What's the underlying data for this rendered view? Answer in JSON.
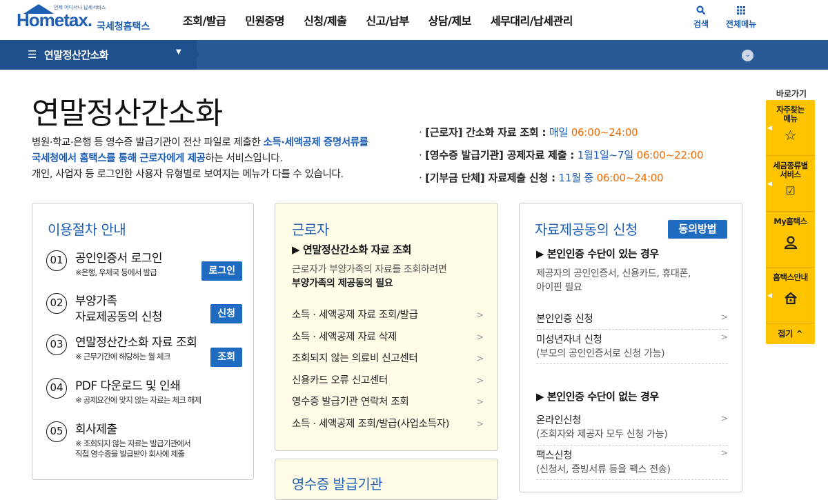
{
  "header": {
    "logo_small": "언제 어디서나 납세서비스",
    "logo_text": "Hometax.",
    "logo_kr": "국세청홈택스",
    "gnb": [
      "조회/발급",
      "민원증명",
      "신청/제출",
      "신고/납부",
      "상담/제보",
      "세무대리/납세관리"
    ],
    "search_label": "검색",
    "allmenu_label": "전체메뉴"
  },
  "locbar": {
    "title": "연말정산간소화"
  },
  "page": {
    "title": "연말정산간소화",
    "desc_1": "병원·학교·은행 등 영수증 발급기관이 전산 파일로 제출한 ",
    "desc_hl1": "소득·세액공제 증명서류를",
    "desc_hl2": "국세청에서 홈택스를 통해 근로자에게 제공",
    "desc_2": "하는 서비스입니다.",
    "desc_3": "개인, 사업자 등 로그인한 사용자 유형별로 보여지는 메뉴가 다를 수 있습니다."
  },
  "schedule": [
    {
      "label": "[근로자] 간소화 자료 조회 :",
      "period": "매일",
      "time": "06:00~24:00"
    },
    {
      "label": "[영수증 발급기관] 공제자료 제출 :",
      "period": "1월1일~7일",
      "time": "06:00~22:00"
    },
    {
      "label": "[기부금 단체] 자료제출 신청 :",
      "period": "11월 중",
      "time": "06:00~24:00"
    }
  ],
  "procedure": {
    "title": "이용절차 안내",
    "steps": [
      {
        "num": "01",
        "label": "공인인증서 로그인",
        "sub": "※은행, 우체국 등에서 발급",
        "button": "로그인"
      },
      {
        "num": "02",
        "label": "부양가족",
        "label2": "자료제공동의 신청",
        "button": "신청"
      },
      {
        "num": "03",
        "label": "연말정산간소화 자료 조회",
        "sub": "※ 근무기간에 해당하는 월 체크",
        "button": "조회"
      },
      {
        "num": "04",
        "label": "PDF 다운로드 및 인쇄",
        "sub": "※ 공제요건에 맞지 않는 자료는 체크 해제"
      },
      {
        "num": "05",
        "label": "회사제출",
        "sub": "※ 조회되지 않는 자료는 발급기관에서",
        "sub2": "직접 영수증을 발급받아 회사에 제출"
      }
    ]
  },
  "worker": {
    "title": "근로자",
    "subtitle": "▶ 연말정산간소화 자료 조회",
    "note1": "근로자가 부양가족의 자료를 조회하려면",
    "note2": "부양가족의 제공동의 필요",
    "items": [
      "소득 · 세액공제 자료 조회/발급",
      "소득 · 세액공제 자료 삭제",
      "조회되지 않는 의료비 신고센터",
      "신용카드 오류 신고센터",
      "영수증 발급기관 연락처 조회",
      "소득 · 세액공제 조회/발급(사업소득자)"
    ]
  },
  "issuer": {
    "title": "영수증 발급기관"
  },
  "consent": {
    "title": "자료제공동의 신청",
    "button": "동의방법",
    "sub1": "▶ 본인인증 수단이 있는 경우",
    "note1": "제공자의 공인인증서, 신용카드, 휴대폰,",
    "note2": "아이핀 필요",
    "items1": [
      {
        "t": "본인인증 신청"
      },
      {
        "t": "미성년자녀 신청",
        "s": "(부모의 공인인증서로 신청 가능)"
      }
    ],
    "sub2": "▶ 본인인증 수단이 없는 경우",
    "items2": [
      {
        "t": "온라인신청",
        "s": "(조회자와 제공자 모두 신청 가능)"
      },
      {
        "t": "팩스신청",
        "s": "(신청서, 증빙서류 등을 팩스 전송)"
      }
    ]
  },
  "quick": {
    "title": "바로가기",
    "items": [
      {
        "l1": "자주찾는",
        "l2": "메뉴",
        "icon": "star-icon"
      },
      {
        "l1": "세금종류별",
        "l2": "서비스",
        "icon": "check-icon"
      },
      {
        "l1": "My홈택스",
        "icon": "user-icon"
      },
      {
        "l1": "홈택스안내",
        "icon": "home-guide-icon"
      }
    ],
    "fold": "접기 ^"
  }
}
